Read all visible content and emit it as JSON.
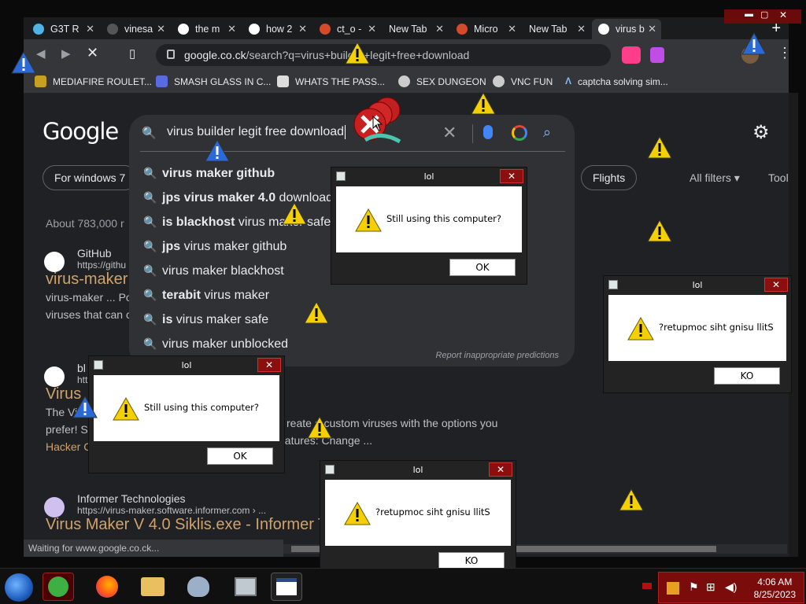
{
  "tabs": [
    {
      "label": "G3T R",
      "color": "#4fb3e8"
    },
    {
      "label": "vinesa",
      "color": "#666666"
    },
    {
      "label": "the m",
      "color": "#ffffff"
    },
    {
      "label": "how 2",
      "color": "#ffffff"
    },
    {
      "label": "ct_o -",
      "color": "#d64a2a"
    },
    {
      "label": "New Tab",
      "color": ""
    },
    {
      "label": "Micro",
      "color": "#d64a2a"
    },
    {
      "label": "New Tab",
      "color": ""
    },
    {
      "label": "virus b",
      "color": "#ffffff"
    }
  ],
  "new_tab_symbol": "+",
  "address": {
    "host": "google.co.ck",
    "path": "/search?q=virus+builder+legit+free+download"
  },
  "bookmarks": [
    {
      "label": "MEDIAFIRE ROULET...",
      "color": "#c8a020"
    },
    {
      "label": "SMASH GLASS IN C...",
      "color": "#5a6adf"
    },
    {
      "label": "WHATS THE PASS...",
      "color": "#222222"
    },
    {
      "label": "SEX DUNGEON",
      "color": "#dddddd"
    },
    {
      "label": "VNC FUN",
      "color": "#dddddd"
    },
    {
      "label": "captcha solving sim...",
      "color": "#8ab4f8"
    }
  ],
  "google": {
    "logo": "Google",
    "query": "virus builder legit free download",
    "suggestions": [
      {
        "prefix": "",
        "bold": "virus maker github",
        "plain": ""
      },
      {
        "prefix": "jps",
        "bold": "virus maker 4.0",
        "plain": " download"
      },
      {
        "prefix": "",
        "bold": "is blackhost",
        "plain": " virus maker safe"
      },
      {
        "prefix": "",
        "bold": "jps",
        "plain": " virus maker github"
      },
      {
        "prefix": "",
        "bold": "",
        "plain": "virus maker blackhost"
      },
      {
        "prefix": "",
        "bold": "terabit",
        "plain": " virus maker"
      },
      {
        "prefix": "",
        "bold": "is",
        "plain": " virus maker safe"
      },
      {
        "prefix": "",
        "bold": "",
        "plain": "virus maker unblocked"
      }
    ],
    "report_text": "Report inappropriate predictions",
    "chips": [
      "For windows 7",
      "Flights"
    ],
    "all_filters": "All filters",
    "tools": "Tools",
    "about": "About 783,000 r",
    "results": [
      {
        "site": "GitHub",
        "url": "https://githu",
        "title": "virus-maker",
        "snippet_a": "virus-maker ... Po",
        "snippet_b": "viruses that can c"
      },
      {
        "site": "bl",
        "url": "htt",
        "title": "Virus",
        "snippet_a": "The Viru",
        "snippet_b": "prefer! S",
        "snippet_c": "Hacker C"
      },
      {
        "site": "Informer Technologies",
        "url": "https://virus-maker.software.informer.com › ...",
        "title": "Virus Maker V 4.0 Siklis.exe - Informer T",
        "snippet_a": "",
        "snippet_b": ""
      }
    ],
    "snippet_fragment_1": "reate a custom viruses with the options you",
    "snippet_fragment_2": "eatures: Change ..."
  },
  "status": "Waiting for www.google.co.ck...",
  "dialogs": [
    {
      "title": "lol",
      "message": "Still using this computer?",
      "button": "OK"
    },
    {
      "title": "lol",
      "message": "?retupmoc siht gnisu llitS",
      "button": "KO"
    },
    {
      "title": "lol",
      "message": "Still using this computer?",
      "button": "OK"
    },
    {
      "title": "lol",
      "message": "?retupmoc siht gnisu llitS",
      "button": "KO"
    }
  ],
  "taskbar": {
    "time": "4:06 AM",
    "date": "8/25/2023"
  },
  "colors": {
    "warn_yellow": "#f5d000",
    "result_title": "#d1a26b",
    "close_red": "#8b0f0f"
  }
}
